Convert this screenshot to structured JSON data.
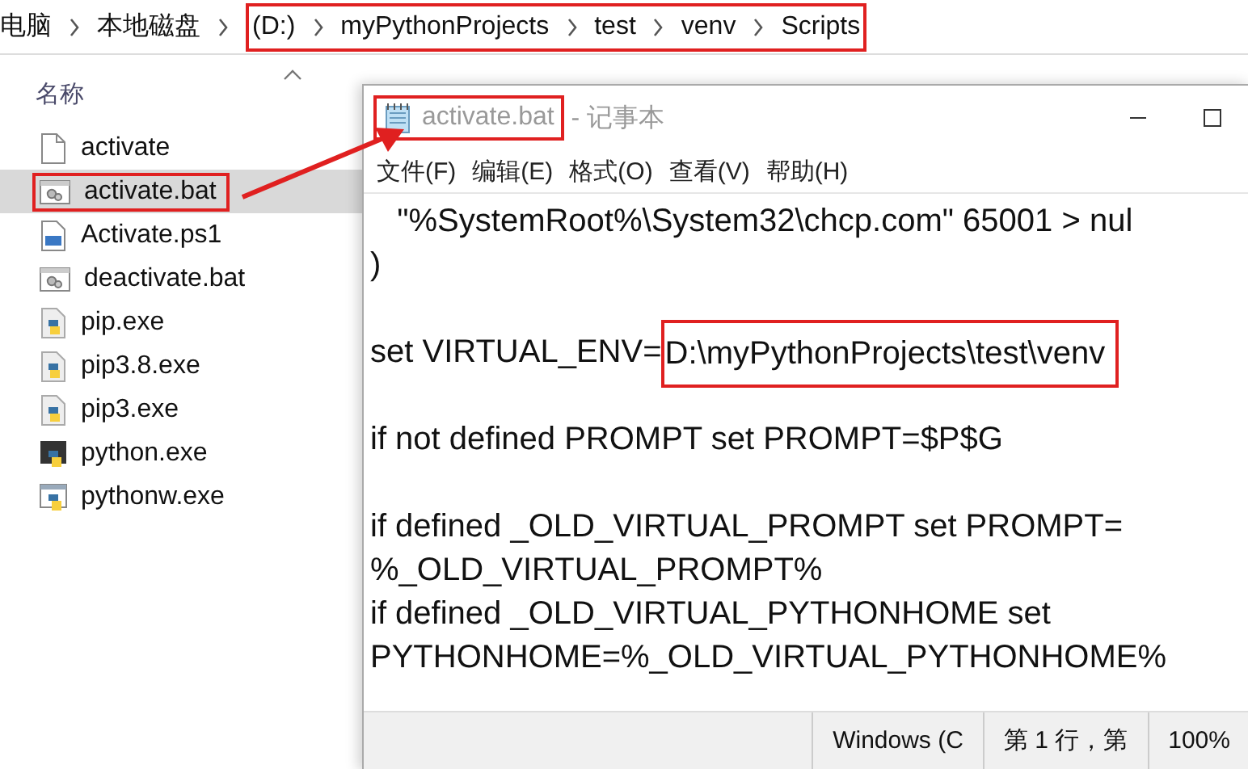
{
  "explorer": {
    "breadcrumb": {
      "path": [
        "电脑",
        "本地磁盘"
      ],
      "highlighted_path": [
        "(D:)",
        "myPythonProjects",
        "test",
        "venv",
        "Scripts"
      ]
    },
    "column_header": "名称",
    "files": [
      {
        "name": "activate",
        "kind": "file",
        "selected": false,
        "framed": false
      },
      {
        "name": "activate.bat",
        "kind": "bat",
        "selected": true,
        "framed": true
      },
      {
        "name": "Activate.ps1",
        "kind": "ps1",
        "selected": false,
        "framed": false
      },
      {
        "name": "deactivate.bat",
        "kind": "bat",
        "selected": false,
        "framed": false
      },
      {
        "name": "pip.exe",
        "kind": "pyexe",
        "selected": false,
        "framed": false
      },
      {
        "name": "pip3.8.exe",
        "kind": "pyexe",
        "selected": false,
        "framed": false
      },
      {
        "name": "pip3.exe",
        "kind": "pyexe",
        "selected": false,
        "framed": false
      },
      {
        "name": "python.exe",
        "kind": "python",
        "selected": false,
        "framed": false
      },
      {
        "name": "pythonw.exe",
        "kind": "pythonw",
        "selected": false,
        "framed": false
      }
    ]
  },
  "notepad": {
    "title": {
      "filename": "activate.bat",
      "app": " - 记事本",
      "framed": true
    },
    "menu": [
      "文件(F)",
      "编辑(E)",
      "格式(O)",
      "查看(V)",
      "帮助(H)"
    ],
    "paragraphs": [
      [
        {
          "text": "   \"%SystemRoot%\\System32\\chcp.com\" 65001 > nul"
        },
        {
          "text": ")"
        }
      ],
      [
        {
          "text": "set VIRTUAL_ENV=",
          "framed": "D:\\myPythonProjects\\test\\venv"
        }
      ],
      [
        {
          "text": "if not defined PROMPT set PROMPT=$P$G"
        }
      ],
      [
        {
          "text": "if defined _OLD_VIRTUAL_PROMPT set PROMPT="
        },
        {
          "text": "%_OLD_VIRTUAL_PROMPT%"
        },
        {
          "text": "if defined _OLD_VIRTUAL_PYTHONHOME set"
        },
        {
          "text": "PYTHONHOME=%_OLD_VIRTUAL_PYTHONHOME%"
        }
      ]
    ],
    "status_bar": [
      "Windows (C",
      "第 1 行，第",
      "100%"
    ]
  }
}
